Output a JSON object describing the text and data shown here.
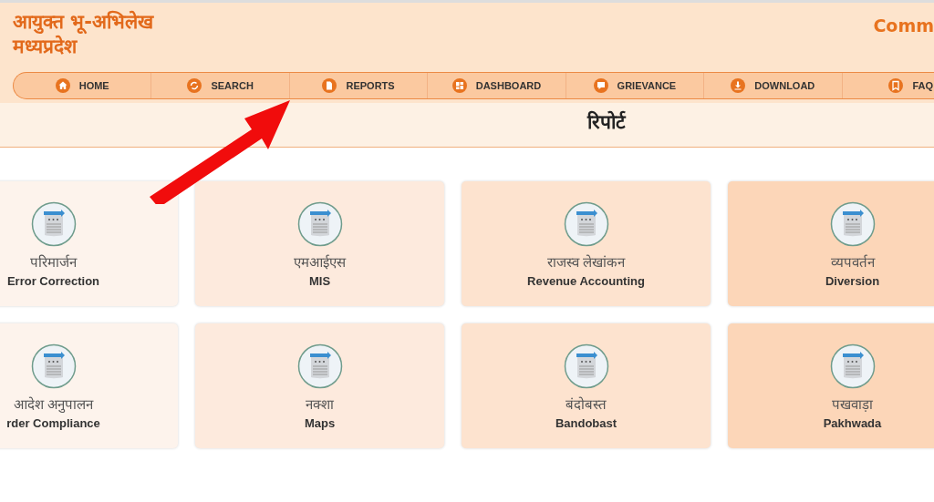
{
  "header": {
    "title_lines": [
      "आयुक्त भू-अभिलेख",
      "मध्यप्रदेश"
    ],
    "title_right": "Comm"
  },
  "nav": [
    {
      "label": "HOME"
    },
    {
      "label": "SEARCH"
    },
    {
      "label": "REPORTS"
    },
    {
      "label": "DASHBOARD"
    },
    {
      "label": "GRIEVANCE"
    },
    {
      "label": "DOWNLOAD"
    },
    {
      "label": "FAQ"
    }
  ],
  "page_title": "रिपोर्ट",
  "cards": [
    {
      "hindi": "परिमार्जन",
      "english": "Error Correction",
      "color": "#fdf3ec"
    },
    {
      "hindi": "एमआईएस",
      "english": "MIS",
      "color": "#fdeadd"
    },
    {
      "hindi": "राजस्व लेखांकन",
      "english": "Revenue Accounting",
      "color": "#fde3cf"
    },
    {
      "hindi": "व्यपवर्तन",
      "english": "Diversion",
      "color": "#fcd6b8"
    },
    {
      "hindi": "आदेश अनुपालन",
      "english": "rder Compliance",
      "color": "#fdf3ec"
    },
    {
      "hindi": "नक्शा",
      "english": "Maps",
      "color": "#fdeadd"
    },
    {
      "hindi": "बंदोबस्त",
      "english": "Bandobast",
      "color": "#fde3cf"
    },
    {
      "hindi": "पखवाड़ा",
      "english": "Pakhwada",
      "color": "#fcd6b8"
    }
  ]
}
